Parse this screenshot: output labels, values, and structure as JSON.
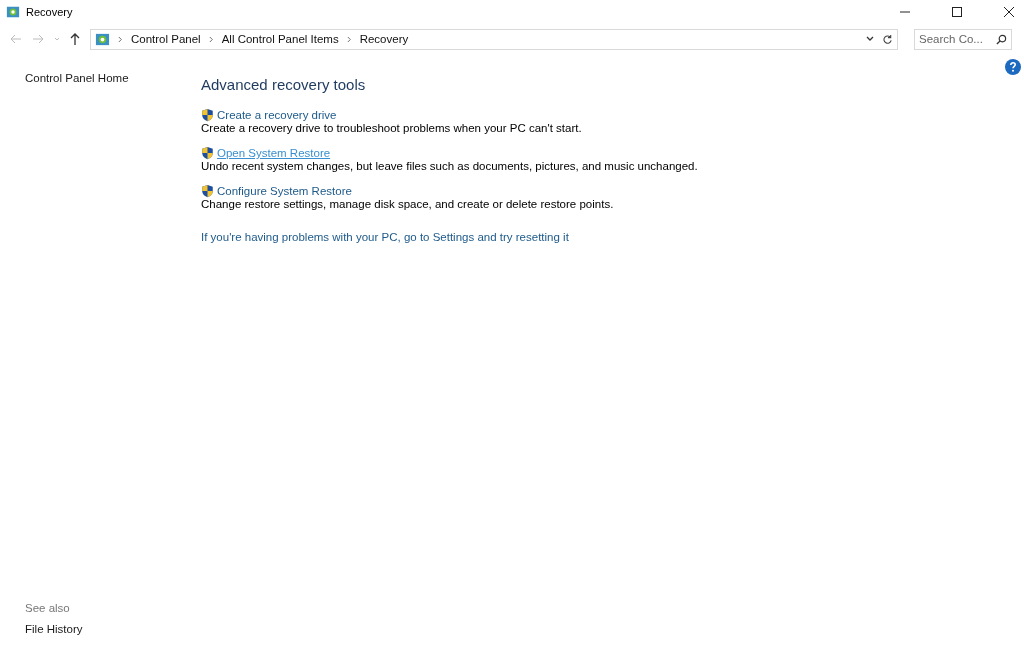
{
  "window": {
    "title": "Recovery"
  },
  "address_bar": {
    "breadcrumbs": [
      "Control Panel",
      "All Control Panel Items",
      "Recovery"
    ]
  },
  "search": {
    "placeholder": "Search Co..."
  },
  "sidebar": {
    "home_link": "Control Panel Home",
    "see_also_heading": "See also",
    "see_also_links": [
      "File History"
    ]
  },
  "main": {
    "heading": "Advanced recovery tools",
    "tools": [
      {
        "label": "Create a recovery drive",
        "description": "Create a recovery drive to troubleshoot problems when your PC can't start.",
        "hovered": false
      },
      {
        "label": "Open System Restore",
        "description": "Undo recent system changes, but leave files such as documents, pictures, and music unchanged.",
        "hovered": true
      },
      {
        "label": "Configure System Restore",
        "description": "Change restore settings, manage disk space, and create or delete restore points.",
        "hovered": false
      }
    ],
    "reset_link": "If you're having problems with your PC, go to Settings and try resetting it"
  }
}
